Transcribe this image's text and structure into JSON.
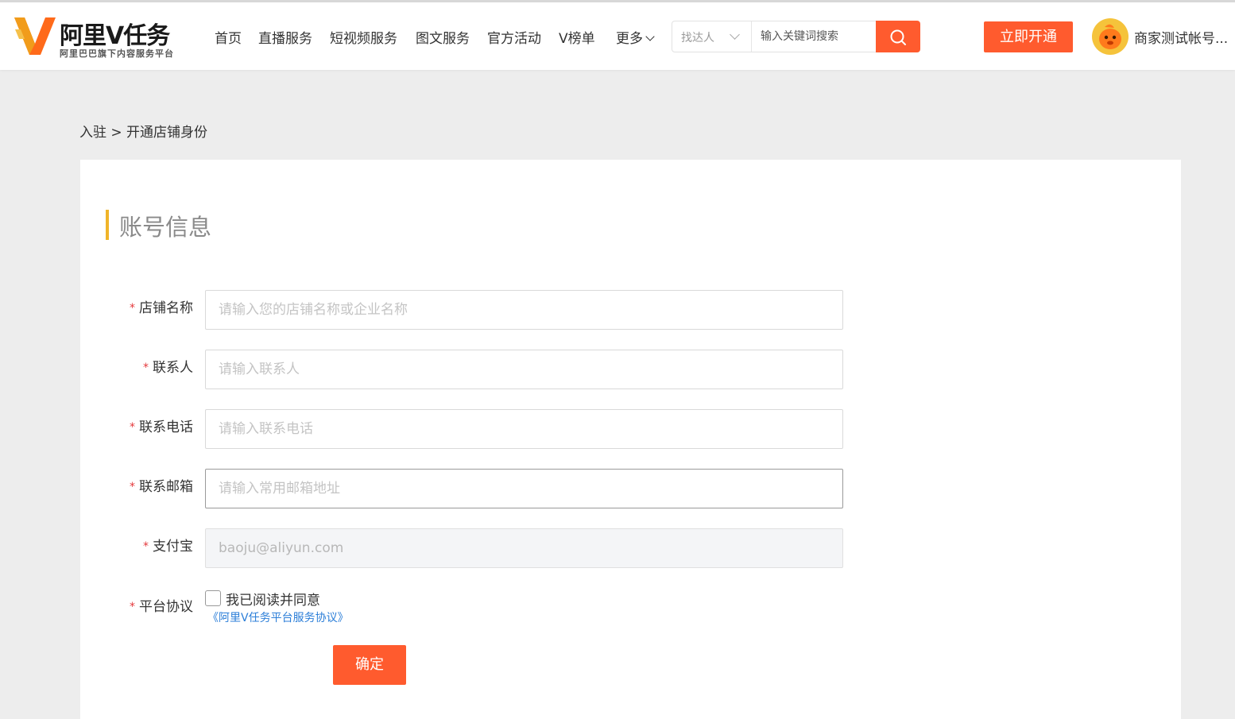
{
  "brand": {
    "title": "阿里V任务",
    "subtitle": "阿里巴巴旗下内容服务平台",
    "accent": "#ff5b2e",
    "logo_colors": [
      "#ff6a1a",
      "#f0a21c"
    ]
  },
  "nav": {
    "items": [
      "首页",
      "直播服务",
      "短视频服务",
      "图文服务",
      "官方活动",
      "V榜单",
      "更多"
    ]
  },
  "search": {
    "type": "找达人",
    "placeholder": "输入关键词搜索",
    "icon": "search-icon"
  },
  "header_actions": {
    "open_label": "立即开通",
    "username": "商家测试帐号..."
  },
  "breadcrumb": "入驻 > 开通店铺身份",
  "section": {
    "title": "账号信息",
    "bar_color": "#f0b429"
  },
  "form": {
    "required_mark": "*",
    "fields": [
      {
        "label": "店铺名称",
        "placeholder": "请输入您的店铺名称或企业名称",
        "value": ""
      },
      {
        "label": "联系人",
        "placeholder": "请输入联系人",
        "value": ""
      },
      {
        "label": "联系电话",
        "placeholder": "请输入联系电话",
        "value": ""
      },
      {
        "label": "联系邮箱",
        "placeholder": "请输入常用邮箱地址",
        "value": ""
      },
      {
        "label": "支付宝",
        "placeholder": "",
        "value": "baoju@aliyun.com"
      }
    ],
    "agreement": {
      "label": "平台协议",
      "checkbox_text": "我已阅读并同意",
      "checked": false,
      "link_text": "《阿里V任务平台服务协议》"
    },
    "submit_label": "确定"
  }
}
